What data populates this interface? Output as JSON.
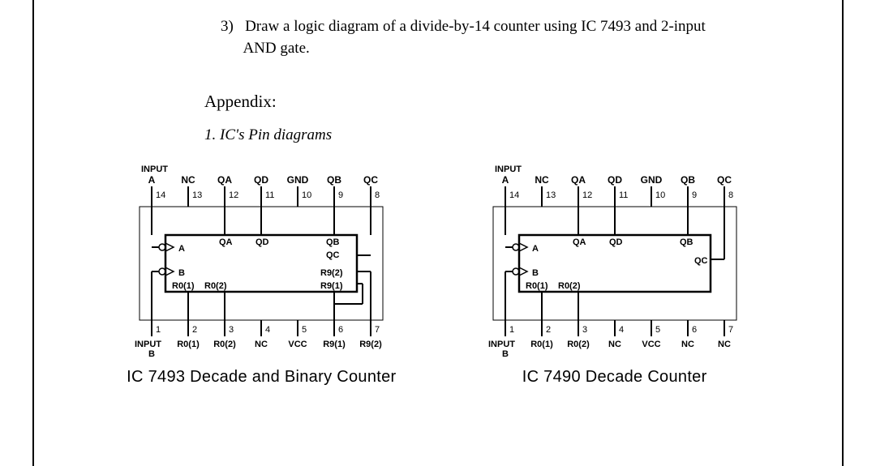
{
  "question": {
    "number": "3)",
    "text_line1": "Draw a logic diagram of a divide-by-14 counter using IC 7493 and 2-input",
    "text_line2": "AND gate."
  },
  "appendix_heading": "Appendix:",
  "sub_heading": "1.   IC's Pin diagrams",
  "diagrams": [
    {
      "caption": "IC 7493 Decade and Binary Counter",
      "input_word": "INPUT",
      "top_pins": [
        {
          "label": "A",
          "num": "14"
        },
        {
          "label": "NC",
          "num": "13"
        },
        {
          "label": "QA",
          "num": "12"
        },
        {
          "label": "QD",
          "num": "11"
        },
        {
          "label": "GND",
          "num": "10"
        },
        {
          "label": "QB",
          "num": "9"
        },
        {
          "label": "QC",
          "num": "8"
        }
      ],
      "bottom_pins": [
        {
          "label_top": "INPUT",
          "label": "B",
          "num": "1"
        },
        {
          "label": "R0(1)",
          "num": "2"
        },
        {
          "label": "R0(2)",
          "num": "3"
        },
        {
          "label": "NC",
          "num": "4"
        },
        {
          "label": "VCC",
          "num": "5"
        },
        {
          "label": "R9(1)",
          "num": "6"
        },
        {
          "label": "R9(2)",
          "num": "7"
        }
      ],
      "inner": {
        "a": "A",
        "b": "B",
        "r01": "R0(1)",
        "r02": "R0(2)",
        "qa": "QA",
        "qd": "QD",
        "qb": "QB",
        "qc": "QC",
        "r91": "R9(1)",
        "r92": "R9(2)"
      }
    },
    {
      "caption": "IC 7490 Decade Counter",
      "input_word": "INPUT",
      "top_pins": [
        {
          "label": "A",
          "num": "14"
        },
        {
          "label": "NC",
          "num": "13"
        },
        {
          "label": "QA",
          "num": "12"
        },
        {
          "label": "QD",
          "num": "11"
        },
        {
          "label": "GND",
          "num": "10"
        },
        {
          "label": "QB",
          "num": "9"
        },
        {
          "label": "QC",
          "num": "8"
        }
      ],
      "bottom_pins": [
        {
          "label_top": "INPUT",
          "label": "B",
          "num": "1"
        },
        {
          "label": "R0(1)",
          "num": "2"
        },
        {
          "label": "R0(2)",
          "num": "3"
        },
        {
          "label": "NC",
          "num": "4"
        },
        {
          "label": "VCC",
          "num": "5"
        },
        {
          "label": "NC",
          "num": "6"
        },
        {
          "label": "NC",
          "num": "7"
        }
      ],
      "inner": {
        "a": "A",
        "b": "B",
        "r01": "R0(1)",
        "r02": "R0(2)",
        "qa": "QA",
        "qd": "QD",
        "qb": "QB",
        "qc": "QC"
      }
    }
  ]
}
